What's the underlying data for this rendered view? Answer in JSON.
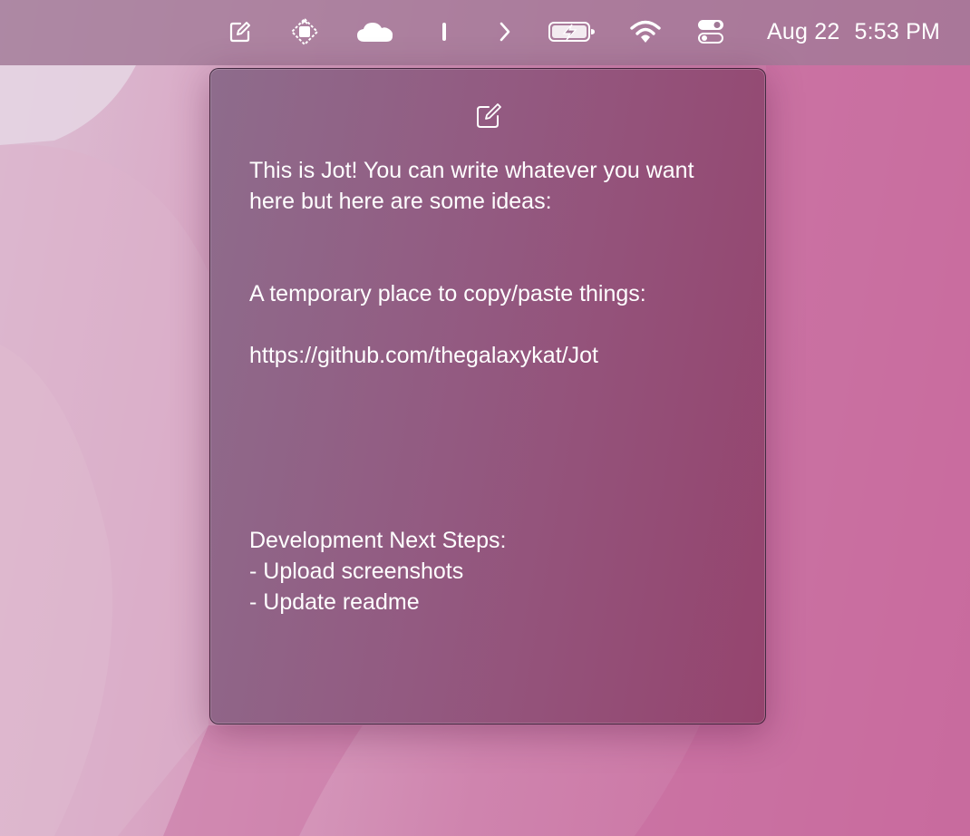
{
  "menubar": {
    "icons": [
      {
        "name": "jot-compose-icon"
      },
      {
        "name": "app-status-icon"
      },
      {
        "name": "cloud-icon"
      },
      {
        "name": "divider-bar-icon"
      },
      {
        "name": "chevron-right-icon"
      },
      {
        "name": "battery-charging-icon"
      },
      {
        "name": "wifi-icon"
      },
      {
        "name": "control-center-icon"
      }
    ],
    "date": "Aug 22",
    "time": "5:53 PM"
  },
  "popover": {
    "compose_icon": "compose-icon",
    "note_text": "This is Jot! You can write whatever you want here but here are some ideas:\n\n\nA temporary place to copy/paste things:\n\nhttps://github.com/thegalaxykat/Jot\n\n\n\n\n\nDevelopment Next Steps:\n- Upload screenshots\n- Update readme"
  },
  "colors": {
    "menubar": "#a07896",
    "panel_start": "#8e6c8c",
    "panel_end": "#95446e",
    "wallpaper": "#c96e9e",
    "text": "#ffffff"
  }
}
